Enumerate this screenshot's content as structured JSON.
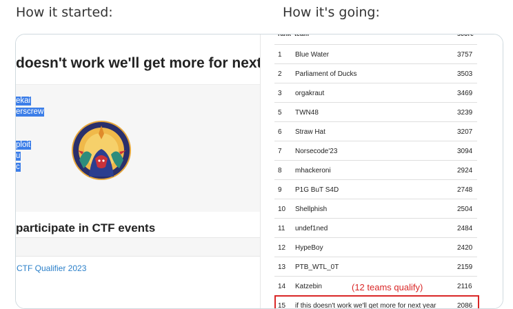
{
  "captions": {
    "left": "How it started:",
    "right": "How it's going:"
  },
  "left_panel": {
    "title": "doesn't work we'll get more for next",
    "selected_lines": [
      "ekai",
      "erscrew",
      "ploit",
      "u",
      "c"
    ],
    "heading": "participate in CTF events",
    "link": "CTF Qualifier 2023"
  },
  "scoreboard": {
    "headers": {
      "rank": "rank",
      "team": "team",
      "score": "score"
    },
    "rows": [
      {
        "rank": "1",
        "team": "Blue Water",
        "score": "3757"
      },
      {
        "rank": "2",
        "team": "Parliament of Ducks",
        "score": "3503"
      },
      {
        "rank": "3",
        "team": "orgakraut",
        "score": "3469"
      },
      {
        "rank": "5",
        "team": "TWN48",
        "score": "3239"
      },
      {
        "rank": "6",
        "team": "Straw Hat",
        "score": "3207"
      },
      {
        "rank": "7",
        "team": "Norsecode'23",
        "score": "3094"
      },
      {
        "rank": "8",
        "team": "mhackeroni",
        "score": "2924"
      },
      {
        "rank": "9",
        "team": "P1G BuT S4D",
        "score": "2748"
      },
      {
        "rank": "10",
        "team": "Shellphish",
        "score": "2504"
      },
      {
        "rank": "11",
        "team": "undef1ned",
        "score": "2484"
      },
      {
        "rank": "12",
        "team": "HypeBoy",
        "score": "2420"
      },
      {
        "rank": "13",
        "team": "PTB_WTL_0T",
        "score": "2159"
      },
      {
        "rank": "14",
        "team": "Katzebin",
        "score": "2116"
      },
      {
        "rank": "15",
        "team": "if this doesn't work we'll get more for next year",
        "score": "2086"
      }
    ],
    "annotation": "(12 teams qualify)"
  },
  "colors": {
    "highlight": "#d92626",
    "selection": "#3c7ee8",
    "link": "#2a7fc9"
  }
}
